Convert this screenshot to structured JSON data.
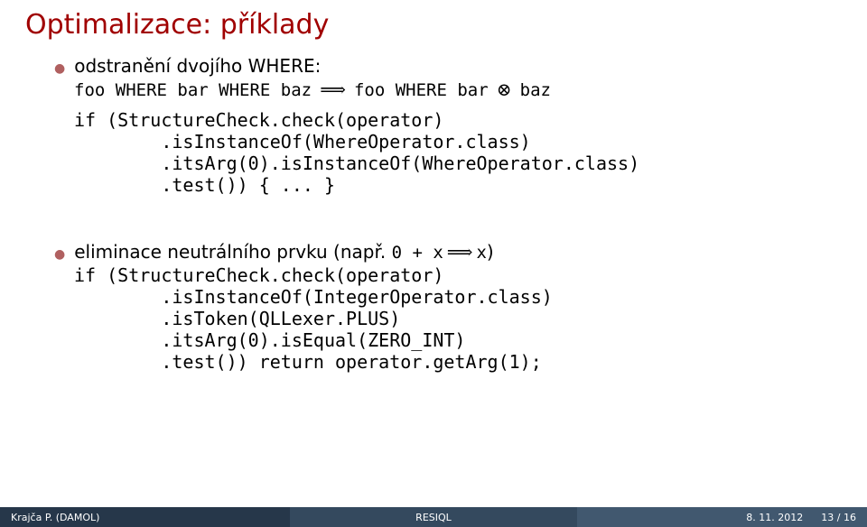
{
  "title": "Optimalizace: příklady",
  "bullet1": {
    "head": "odstranění dvojího WHERE:",
    "expr_left_a": "foo WHERE bar WHERE baz",
    "expr_right_a": "foo WHERE bar",
    "expr_right_tail": "baz",
    "code": "if (StructureCheck.check(operator)\n        .isInstanceOf(WhereOperator.class)\n        .itsArg(0).isInstanceOf(WhereOperator.class)\n        .test()) { ... }"
  },
  "bullet2": {
    "head_a": "eliminace neutrálního prvku (např. ",
    "expr_left": "0 + x",
    "expr_right": "x",
    "head_b": ")",
    "code": "if (StructureCheck.check(operator)\n        .isInstanceOf(IntegerOperator.class)\n        .isToken(QLLexer.PLUS)\n        .itsArg(0).isEqual(ZERO_INT)\n        .test()) return operator.getArg(1);"
  },
  "symbols": {
    "longrightarrow": "⟹",
    "otimes": "⊗"
  },
  "footer": {
    "left": "Krajča P. (DAMOL)",
    "center": "RESIQL",
    "date": "8. 11. 2012",
    "page": "13 / 16"
  }
}
